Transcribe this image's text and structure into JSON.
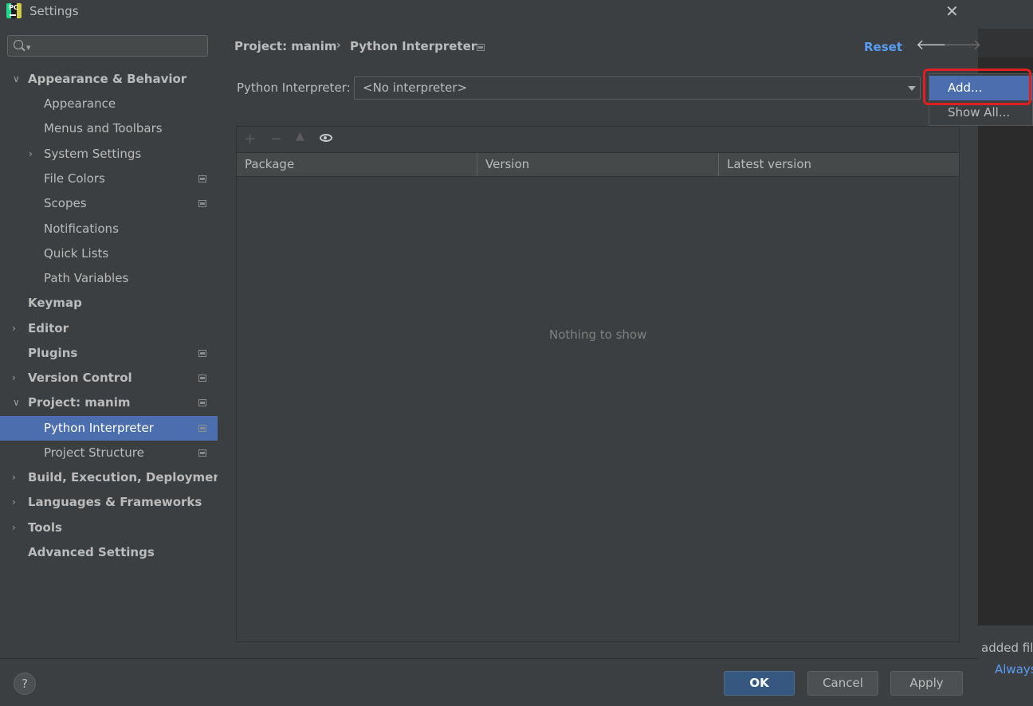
{
  "window": {
    "title": "Settings"
  },
  "search": {
    "placeholder": ""
  },
  "sidebar": {
    "items": [
      {
        "label": "Appearance & Behavior",
        "bold": true,
        "chevron": "down"
      },
      {
        "label": "Appearance"
      },
      {
        "label": "Menus and Toolbars"
      },
      {
        "label": "System Settings",
        "chevron": "right"
      },
      {
        "label": "File Colors",
        "project_icon": true
      },
      {
        "label": "Scopes",
        "project_icon": true
      },
      {
        "label": "Notifications"
      },
      {
        "label": "Quick Lists"
      },
      {
        "label": "Path Variables"
      },
      {
        "label": "Keymap",
        "bold": true
      },
      {
        "label": "Editor",
        "bold": true,
        "chevron": "right"
      },
      {
        "label": "Plugins",
        "bold": true,
        "project_icon": true
      },
      {
        "label": "Version Control",
        "bold": true,
        "chevron": "right",
        "project_icon": true
      },
      {
        "label": "Project: manim",
        "bold": true,
        "chevron": "down",
        "project_icon": true
      },
      {
        "label": "Python Interpreter",
        "selected": true,
        "project_icon": true
      },
      {
        "label": "Project Structure",
        "project_icon": true
      },
      {
        "label": "Build, Execution, Deployment",
        "bold": true,
        "chevron": "right"
      },
      {
        "label": "Languages & Frameworks",
        "bold": true,
        "chevron": "right"
      },
      {
        "label": "Tools",
        "bold": true,
        "chevron": "right"
      },
      {
        "label": "Advanced Settings",
        "bold": true
      }
    ]
  },
  "header": {
    "breadcrumb": [
      "Project: manim",
      "Python Interpreter"
    ],
    "reset_label": "Reset",
    "back_icon": "arrow-left-icon",
    "forward_icon": "arrow-right-icon"
  },
  "interpreter": {
    "label": "Python Interpreter:",
    "value": "<No interpreter>"
  },
  "packages": {
    "toolbar": [
      "plus-icon",
      "minus-icon",
      "upgrade-icon",
      "eye-icon"
    ],
    "columns": [
      "Package",
      "Version",
      "Latest version"
    ],
    "rows": [],
    "empty_text": "Nothing to show"
  },
  "popup": {
    "items": [
      {
        "label": "Add...",
        "selected": true
      },
      {
        "label": "Show All..."
      }
    ]
  },
  "footer": {
    "help_label": "?",
    "ok_label": "OK",
    "cancel_label": "Cancel",
    "apply_label": "Apply"
  },
  "background": {
    "notification_text": "added fil",
    "notification_link": "Always"
  },
  "colors": {
    "accent": "#4b6eaf",
    "link": "#589df6",
    "highlight": "#e02020"
  }
}
